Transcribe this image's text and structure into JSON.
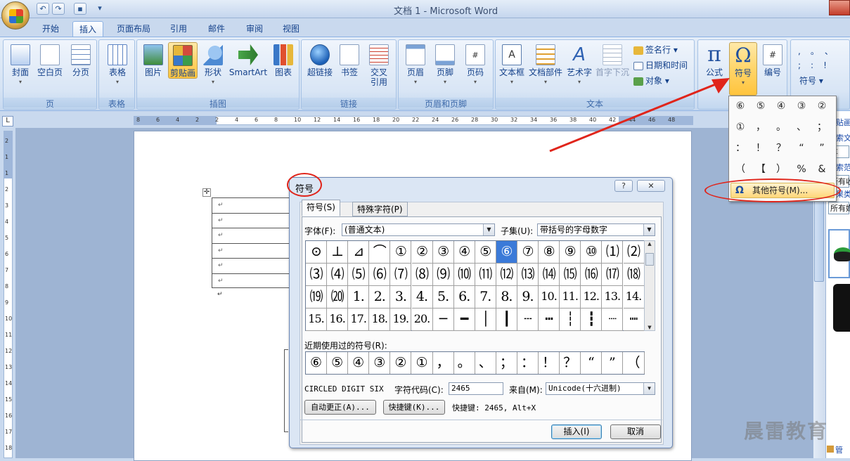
{
  "window": {
    "title": "文档 1 - Microsoft Word"
  },
  "tabs": [
    "开始",
    "插入",
    "页面布局",
    "引用",
    "邮件",
    "审阅",
    "视图"
  ],
  "ribbon": {
    "groups": {
      "page": {
        "label": "页",
        "buttons": [
          "封面",
          "空白页",
          "分页"
        ]
      },
      "table": {
        "label": "表格",
        "buttons": [
          "表格"
        ]
      },
      "illustrations": {
        "label": "插图",
        "buttons": [
          "图片",
          "剪贴画",
          "形状",
          "SmartArt",
          "图表"
        ]
      },
      "links": {
        "label": "链接",
        "buttons": [
          "超链接",
          "书签",
          "交叉\n引用"
        ]
      },
      "header_footer": {
        "label": "页眉和页脚",
        "buttons": [
          "页眉",
          "页脚",
          "页码"
        ]
      },
      "text": {
        "label": "文本",
        "buttons": [
          "文本框",
          "文档部件",
          "艺术字",
          "首字下沉"
        ],
        "small": [
          "签名行 ▾",
          "日期和时间",
          "对象 ▾"
        ]
      },
      "symbols": {
        "buttons": [
          "公式",
          "符号",
          "编号"
        ]
      },
      "special": {
        "chars": [
          ",",
          "。",
          "、",
          ";",
          ":",
          "!"
        ],
        "label": "符号 ▾"
      }
    }
  },
  "ruler_top_numbers": [
    "8",
    "6",
    "4",
    "2",
    "2",
    "4",
    "6",
    "8",
    "10",
    "12",
    "14",
    "16",
    "18",
    "20",
    "22",
    "24",
    "26",
    "28",
    "30",
    "32",
    "34",
    "36",
    "38",
    "40",
    "42",
    "44",
    "46",
    "48"
  ],
  "ruler_left_numbers": [
    "2",
    "1",
    "1",
    "2",
    "3",
    "4",
    "5",
    "6",
    "7",
    "8",
    "9",
    "10",
    "11",
    "12",
    "13",
    "14",
    "15",
    "16",
    "17",
    "18"
  ],
  "document": {
    "row_marks": [
      "↵",
      "↵",
      "↵",
      "↵",
      "↵",
      "↵"
    ],
    "table_move": "✛",
    "cursor_mark": "↵"
  },
  "symbol_dropdown": {
    "symbols": [
      "⑥",
      "⑤",
      "④",
      "③",
      "②",
      "①",
      "，",
      "。",
      "、",
      "；",
      "：",
      "！",
      "？",
      "“",
      "”",
      "（",
      "【",
      "）",
      "%",
      "&"
    ],
    "more_label": "其他符号(M)...",
    "more_icon": "Ω"
  },
  "right_panel": {
    "texts": [
      "剪贴画",
      "搜索文",
      "车",
      "搜索范",
      "所有收",
      "结果类",
      "所有媒"
    ],
    "footer": "管"
  },
  "dialog": {
    "title": "符号",
    "help": "?",
    "close": "✕",
    "tabs": [
      "符号(S)",
      "特殊字符(P)"
    ],
    "font_label": "字体(F):",
    "font_value": "(普通文本)",
    "subset_label": "子集(U):",
    "subset_value": "带括号的字母数字",
    "grid": [
      [
        "⊙",
        "⊥",
        "⊿",
        "⌒",
        "①",
        "②",
        "③",
        "④",
        "⑤",
        "⑥",
        "⑦",
        "⑧",
        "⑨",
        "⑩",
        "⑴",
        "⑵"
      ],
      [
        "⑶",
        "⑷",
        "⑸",
        "⑹",
        "⑺",
        "⑻",
        "⑼",
        "⑽",
        "⑾",
        "⑿",
        "⒀",
        "⒁",
        "⒂",
        "⒃",
        "⒄",
        "⒅"
      ],
      [
        "⒆",
        "⒇",
        "1.",
        "2.",
        "3.",
        "4.",
        "5.",
        "6.",
        "7.",
        "8.",
        "9.",
        "10.",
        "11.",
        "12.",
        "13.",
        "14."
      ],
      [
        "15.",
        "16.",
        "17.",
        "18.",
        "19.",
        "20.",
        "─",
        "━",
        "│",
        "┃",
        "┄",
        "┅",
        "┆",
        "┇",
        "┈",
        "┉"
      ]
    ],
    "selected": "⑥",
    "recent_label": "近期使用过的符号(R):",
    "recent": [
      "⑥",
      "⑤",
      "④",
      "③",
      "②",
      "①",
      "，",
      "。",
      "、",
      "；",
      "：",
      "！",
      "？",
      "“",
      "”",
      "（"
    ],
    "char_name": "CIRCLED DIGIT SIX",
    "code_label": "字符代码(C):",
    "code_value": "2465",
    "from_label": "来自(M):",
    "from_value": "Unicode(十六进制)",
    "autocorrect_btn": "自动更正(A)...",
    "shortcut_btn": "快捷键(K)...",
    "shortcut_text": "快捷键: 2465, Alt+X",
    "insert_btn": "插入(I)",
    "cancel_btn": "取消"
  },
  "watermark": "晨雷教育",
  "colors": {
    "annotation": "#e0251b",
    "selected_cell": "#3b7ad8",
    "ribbon_highlight": "#ffd56a"
  }
}
